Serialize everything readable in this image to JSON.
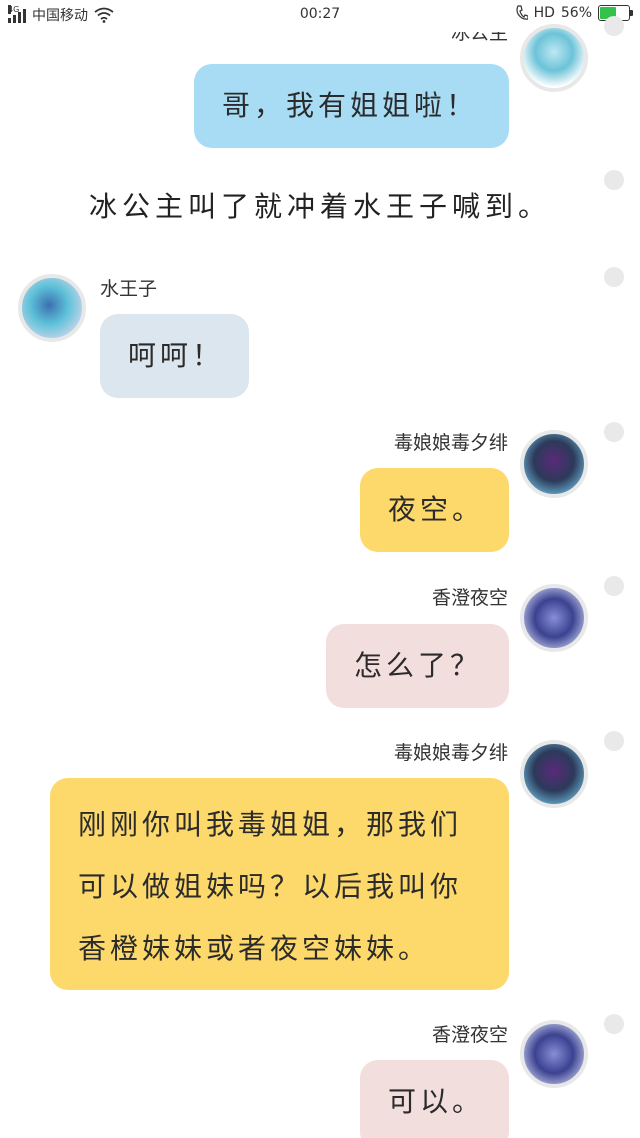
{
  "status_bar": {
    "network": "4G",
    "carrier": "中国移动",
    "time": "00:27",
    "hd": "HD",
    "battery_percent": "56%",
    "battery_level": 0.56
  },
  "messages": [
    {
      "sender": "冰公主",
      "text": "哥，我有姐姐啦！",
      "side": "right",
      "avatar": "ice-princess-avatar"
    },
    {
      "narration": "冰公主叫了就冲着水王子喊到。"
    },
    {
      "sender": "水王子",
      "text": "呵呵！",
      "side": "left",
      "avatar": "water-prince-avatar"
    },
    {
      "sender": "毒娘娘毒夕绯",
      "text": "夜空。",
      "side": "right",
      "avatar": "poison-lady-avatar"
    },
    {
      "sender": "香澄夜空",
      "text": "怎么了？",
      "side": "right",
      "avatar": "kasumi-yozora-avatar"
    },
    {
      "sender": "毒娘娘毒夕绯",
      "lines": [
        "刚刚你叫我毒姐姐，那我们",
        "可以做姐妹吗？以后我叫你",
        "香橙妹妹或者夜空妹妹。"
      ],
      "side": "right",
      "avatar": "poison-lady-avatar"
    },
    {
      "sender": "香澄夜空",
      "text": "可以。",
      "side": "right",
      "avatar": "kasumi-yozora-avatar"
    }
  ],
  "colors": {
    "bubble_blue": "#a8dcf5",
    "bubble_gray": "#dce6ee",
    "bubble_yellow": "#fcd96a",
    "bubble_pink": "#f3dede",
    "battery_green": "#34c24a"
  }
}
